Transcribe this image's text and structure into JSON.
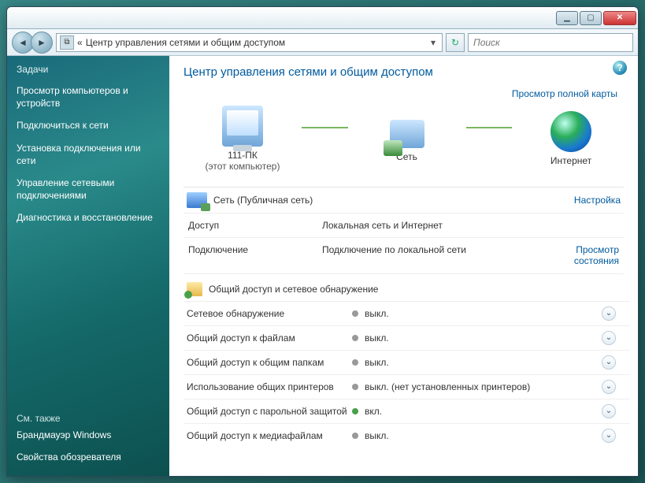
{
  "window": {
    "breadcrumb_prefix": "«",
    "breadcrumb": "Центр управления сетями и общим доступом",
    "search_placeholder": "Поиск"
  },
  "sidebar": {
    "header": "Задачи",
    "items": [
      "Просмотр компьютеров и устройств",
      "Подключиться к сети",
      "Установка подключения или сети",
      "Управление сетевыми подключениями",
      "Диагностика и восстановление"
    ],
    "see_also_header": "См. также",
    "see_also": [
      "Брандмауэр Windows",
      "Свойства обозревателя"
    ]
  },
  "content": {
    "title": "Центр управления сетями и общим доступом",
    "view_full_map": "Просмотр полной карты",
    "map": {
      "pc_name": "111-ПК",
      "pc_sub": "(этот компьютер)",
      "network_label": "Сеть",
      "internet_label": "Интернет"
    },
    "network": {
      "name": "Сеть (Публичная сеть)",
      "customize": "Настройка",
      "rows": [
        {
          "k": "Доступ",
          "v": "Локальная сеть и Интернет",
          "act": ""
        },
        {
          "k": "Подключение",
          "v": "Подключение по локальной сети",
          "act": "Просмотр состояния"
        }
      ]
    },
    "sharing": {
      "header": "Общий доступ и сетевое обнаружение",
      "rows": [
        {
          "label": "Сетевое обнаружение",
          "value": "выкл.",
          "on": false
        },
        {
          "label": "Общий доступ к файлам",
          "value": "выкл.",
          "on": false
        },
        {
          "label": "Общий доступ к общим папкам",
          "value": "выкл.",
          "on": false
        },
        {
          "label": "Использование общих принтеров",
          "value": "выкл. (нет установленных принтеров)",
          "on": false
        },
        {
          "label": "Общий доступ с парольной защитой",
          "value": "вкл.",
          "on": true
        },
        {
          "label": "Общий доступ к медиафайлам",
          "value": "выкл.",
          "on": false
        }
      ]
    }
  }
}
